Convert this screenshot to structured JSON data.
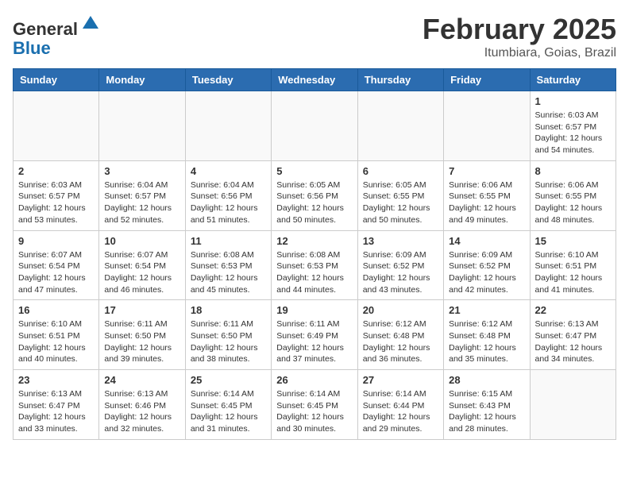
{
  "header": {
    "logo_line1": "General",
    "logo_line2": "Blue",
    "month_title": "February 2025",
    "location": "Itumbiara, Goias, Brazil"
  },
  "days_of_week": [
    "Sunday",
    "Monday",
    "Tuesday",
    "Wednesday",
    "Thursday",
    "Friday",
    "Saturday"
  ],
  "weeks": [
    [
      {
        "day": "",
        "info": ""
      },
      {
        "day": "",
        "info": ""
      },
      {
        "day": "",
        "info": ""
      },
      {
        "day": "",
        "info": ""
      },
      {
        "day": "",
        "info": ""
      },
      {
        "day": "",
        "info": ""
      },
      {
        "day": "1",
        "info": "Sunrise: 6:03 AM\nSunset: 6:57 PM\nDaylight: 12 hours and 54 minutes."
      }
    ],
    [
      {
        "day": "2",
        "info": "Sunrise: 6:03 AM\nSunset: 6:57 PM\nDaylight: 12 hours and 53 minutes."
      },
      {
        "day": "3",
        "info": "Sunrise: 6:04 AM\nSunset: 6:57 PM\nDaylight: 12 hours and 52 minutes."
      },
      {
        "day": "4",
        "info": "Sunrise: 6:04 AM\nSunset: 6:56 PM\nDaylight: 12 hours and 51 minutes."
      },
      {
        "day": "5",
        "info": "Sunrise: 6:05 AM\nSunset: 6:56 PM\nDaylight: 12 hours and 50 minutes."
      },
      {
        "day": "6",
        "info": "Sunrise: 6:05 AM\nSunset: 6:55 PM\nDaylight: 12 hours and 50 minutes."
      },
      {
        "day": "7",
        "info": "Sunrise: 6:06 AM\nSunset: 6:55 PM\nDaylight: 12 hours and 49 minutes."
      },
      {
        "day": "8",
        "info": "Sunrise: 6:06 AM\nSunset: 6:55 PM\nDaylight: 12 hours and 48 minutes."
      }
    ],
    [
      {
        "day": "9",
        "info": "Sunrise: 6:07 AM\nSunset: 6:54 PM\nDaylight: 12 hours and 47 minutes."
      },
      {
        "day": "10",
        "info": "Sunrise: 6:07 AM\nSunset: 6:54 PM\nDaylight: 12 hours and 46 minutes."
      },
      {
        "day": "11",
        "info": "Sunrise: 6:08 AM\nSunset: 6:53 PM\nDaylight: 12 hours and 45 minutes."
      },
      {
        "day": "12",
        "info": "Sunrise: 6:08 AM\nSunset: 6:53 PM\nDaylight: 12 hours and 44 minutes."
      },
      {
        "day": "13",
        "info": "Sunrise: 6:09 AM\nSunset: 6:52 PM\nDaylight: 12 hours and 43 minutes."
      },
      {
        "day": "14",
        "info": "Sunrise: 6:09 AM\nSunset: 6:52 PM\nDaylight: 12 hours and 42 minutes."
      },
      {
        "day": "15",
        "info": "Sunrise: 6:10 AM\nSunset: 6:51 PM\nDaylight: 12 hours and 41 minutes."
      }
    ],
    [
      {
        "day": "16",
        "info": "Sunrise: 6:10 AM\nSunset: 6:51 PM\nDaylight: 12 hours and 40 minutes."
      },
      {
        "day": "17",
        "info": "Sunrise: 6:11 AM\nSunset: 6:50 PM\nDaylight: 12 hours and 39 minutes."
      },
      {
        "day": "18",
        "info": "Sunrise: 6:11 AM\nSunset: 6:50 PM\nDaylight: 12 hours and 38 minutes."
      },
      {
        "day": "19",
        "info": "Sunrise: 6:11 AM\nSunset: 6:49 PM\nDaylight: 12 hours and 37 minutes."
      },
      {
        "day": "20",
        "info": "Sunrise: 6:12 AM\nSunset: 6:48 PM\nDaylight: 12 hours and 36 minutes."
      },
      {
        "day": "21",
        "info": "Sunrise: 6:12 AM\nSunset: 6:48 PM\nDaylight: 12 hours and 35 minutes."
      },
      {
        "day": "22",
        "info": "Sunrise: 6:13 AM\nSunset: 6:47 PM\nDaylight: 12 hours and 34 minutes."
      }
    ],
    [
      {
        "day": "23",
        "info": "Sunrise: 6:13 AM\nSunset: 6:47 PM\nDaylight: 12 hours and 33 minutes."
      },
      {
        "day": "24",
        "info": "Sunrise: 6:13 AM\nSunset: 6:46 PM\nDaylight: 12 hours and 32 minutes."
      },
      {
        "day": "25",
        "info": "Sunrise: 6:14 AM\nSunset: 6:45 PM\nDaylight: 12 hours and 31 minutes."
      },
      {
        "day": "26",
        "info": "Sunrise: 6:14 AM\nSunset: 6:45 PM\nDaylight: 12 hours and 30 minutes."
      },
      {
        "day": "27",
        "info": "Sunrise: 6:14 AM\nSunset: 6:44 PM\nDaylight: 12 hours and 29 minutes."
      },
      {
        "day": "28",
        "info": "Sunrise: 6:15 AM\nSunset: 6:43 PM\nDaylight: 12 hours and 28 minutes."
      },
      {
        "day": "",
        "info": ""
      }
    ]
  ]
}
